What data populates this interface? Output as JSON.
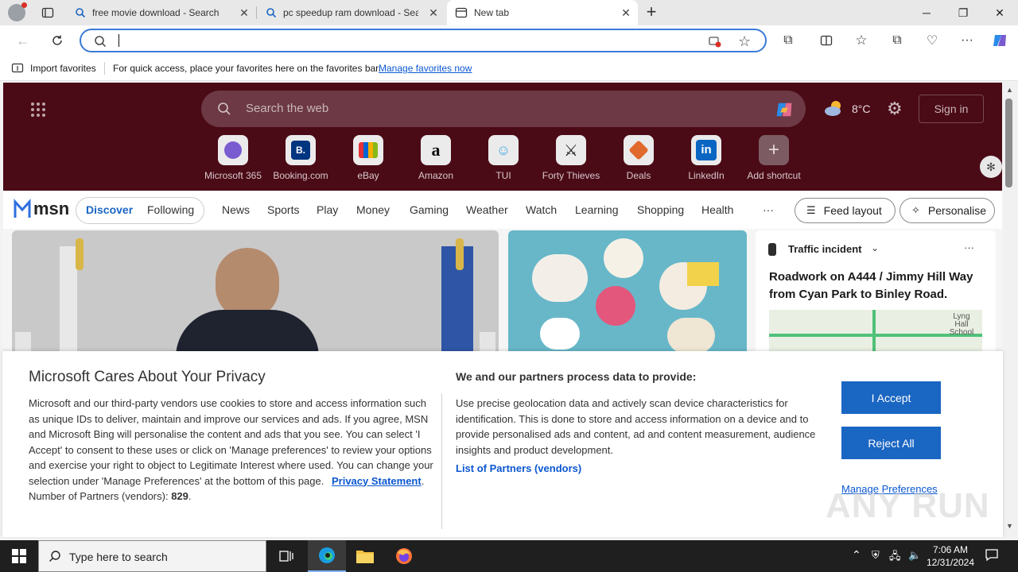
{
  "tabs": [
    {
      "title": "free movie download - Search",
      "icon": "search-icon"
    },
    {
      "title": "pc speedup ram download - Search",
      "icon": "search-icon"
    },
    {
      "title": "New tab",
      "icon": "new-tab-icon",
      "active": true
    }
  ],
  "address_bar": {
    "value": "",
    "placeholder": ""
  },
  "favorites_bar": {
    "import_label": "Import favorites",
    "hint": "For quick access, place your favorites here on the favorites bar.",
    "manage_link": "Manage favorites now"
  },
  "msn": {
    "search_placeholder": "Search the web",
    "weather_temp": "8°C",
    "sign_in": "Sign in",
    "shortcuts": [
      {
        "label": "Microsoft 365",
        "color": "#7a5cd1"
      },
      {
        "label": "Booking.com",
        "color": "#003580"
      },
      {
        "label": "eBay",
        "color": "#e53238"
      },
      {
        "label": "Amazon",
        "color": "#111111"
      },
      {
        "label": "TUI",
        "color": "#71c4e8"
      },
      {
        "label": "Forty Thieves",
        "color": "#222222"
      },
      {
        "label": "Deals",
        "color": "#e06a2c"
      },
      {
        "label": "LinkedIn",
        "color": "#0a66c2"
      },
      {
        "label": "Add shortcut",
        "color": "#888888"
      }
    ],
    "nav": {
      "logo": "msn",
      "discover": "Discover",
      "following": "Following",
      "items": [
        "News",
        "Sports",
        "Play",
        "Money",
        "Gaming",
        "Weather",
        "Watch",
        "Learning",
        "Shopping",
        "Health"
      ],
      "more": "···",
      "feed_layout": "Feed layout",
      "personalise": "Personalise"
    },
    "traffic_card": {
      "heading": "Traffic incident",
      "headline": "Roadwork on A444 / Jimmy Hill Way from Cyan Park to Binley Road.",
      "map_label": "Lyng Hall School"
    }
  },
  "privacy": {
    "title": "Microsoft Cares About Your Privacy",
    "body": "Microsoft and our third-party vendors use cookies to store and access information such as unique IDs to deliver, maintain and improve our services and ads. If you agree, MSN and Microsoft Bing will personalise the content and ads that you see. You can select 'I Accept' to consent to these uses or click on 'Manage preferences' to review your options and exercise your right to object to Legitimate Interest where used.  You can change your selection under 'Manage Preferences' at the bottom of this page.",
    "privacy_link": "Privacy Statement",
    "partners_prefix": "Number of Partners (vendors):",
    "partners_count": "829",
    "purposes_title": "We and our partners process data to provide:",
    "purposes_body": "Use precise geolocation data and actively scan device characteristics for identification. This is done to store and access information on a device and to provide personalised ads and content, ad and content measurement, audience insights and product development.",
    "partners_link": "List of Partners (vendors)",
    "accept": "I Accept",
    "reject": "Reject All",
    "manage": "Manage Preferences"
  },
  "taskbar": {
    "search_placeholder": "Type here to search",
    "time": "7:06 AM",
    "date": "12/31/2024"
  },
  "watermark": "ANY RUN"
}
